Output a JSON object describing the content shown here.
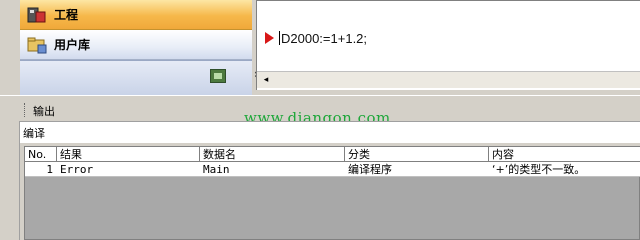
{
  "nav": {
    "items": [
      {
        "label": "工程",
        "icon": "project-icon",
        "active": true
      },
      {
        "label": "用户库",
        "icon": "user-library-icon",
        "active": false
      }
    ],
    "footer_icons": [
      "save-icon",
      "chevron-double-right-icon"
    ]
  },
  "editor": {
    "code": "D2000:=1+1.2;",
    "breakpoint_color": "#d81818"
  },
  "output": {
    "title": "输出",
    "active_tab": "编译",
    "watermark": "www.diangon.com",
    "columns": [
      "No.",
      "结果",
      "数据名",
      "分类",
      "内容"
    ],
    "rows": [
      {
        "no": "1",
        "result": "Error",
        "data_name": "Main",
        "category": "编译程序",
        "content": "‘+’的类型不一致。"
      }
    ]
  },
  "colors": {
    "active_nav": "#f6b84a",
    "watermark": "#1ea73a",
    "grid_empty": "#a8a8a8"
  }
}
